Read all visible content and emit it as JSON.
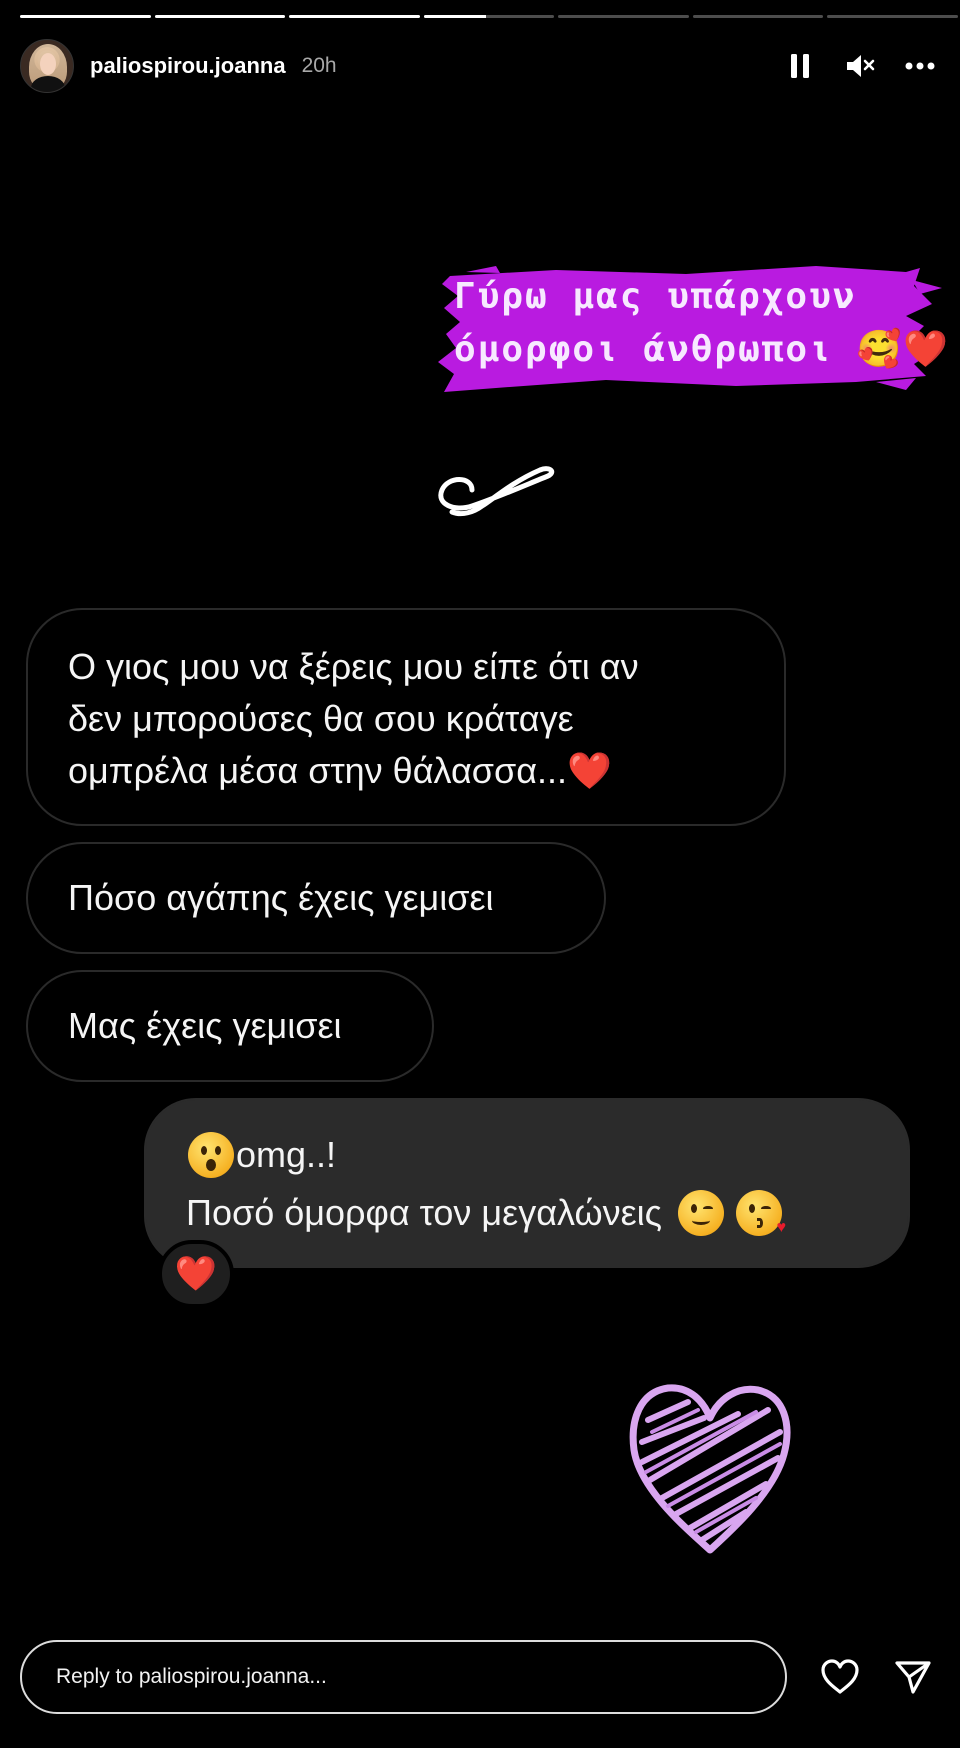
{
  "story": {
    "segments": [
      1,
      1,
      1,
      0.5,
      0,
      0,
      0
    ],
    "username": "paliospirou.joanna",
    "time": "20h"
  },
  "header": {
    "avatar_icon": "profile-avatar",
    "pause_icon": "pause-icon",
    "mute_icon": "speaker-muted-icon",
    "more_icon": "more-options-icon"
  },
  "sticker": {
    "line1": "Γύρω μας υπάρχουν",
    "line2": "όμορφοι άνθρωποι 🥰❤️",
    "highlight_color": "#b91be0"
  },
  "messages": {
    "m1_line1": "Ο γιος μου να ξέρεις μου είπε ότι αν",
    "m1_line2": "δεν μπορούσες θα σου κράταγε",
    "m1_line3": "ομπρέλα μέσα στην θάλασσα...",
    "m1_emoji": "❤️",
    "m2": "Πόσο αγάπης έχεις γεμισει",
    "m3": "Μας έχεις γεμισει",
    "m4_line1": "omg..!",
    "m4_line2": "Ποσό όμορφα τον μεγαλώνεις",
    "reaction": "❤️"
  },
  "footer": {
    "reply_placeholder": "Reply to paliospirou.joanna...",
    "like_icon": "heart-outline-icon",
    "share_icon": "send-icon"
  }
}
